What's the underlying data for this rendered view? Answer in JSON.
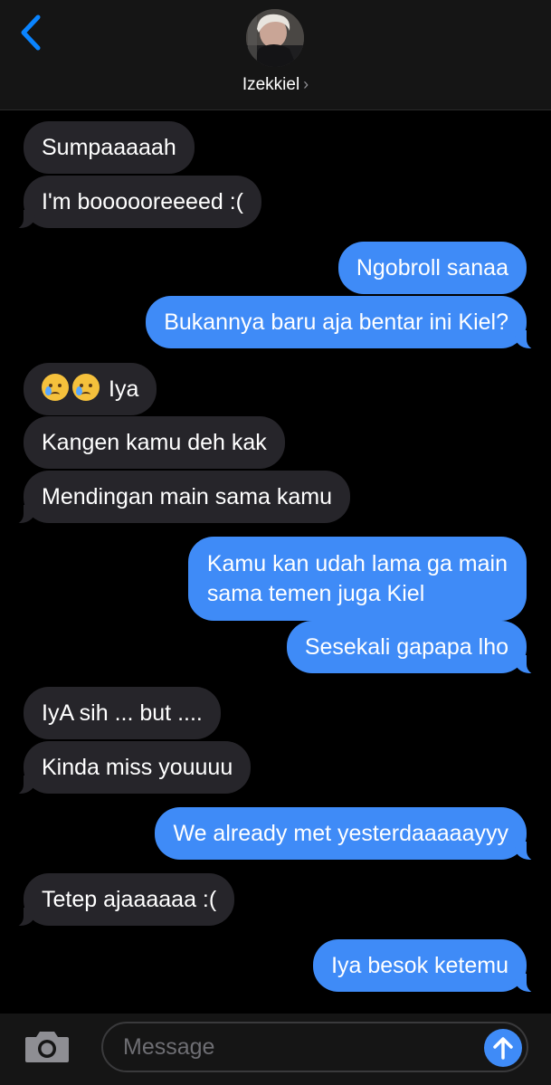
{
  "header": {
    "contact_name": "Izekkiel",
    "chevron": "›",
    "back_icon": "chevron-left-icon",
    "avatar": "contact-avatar"
  },
  "colors": {
    "incoming": "#26252a",
    "outgoing": "#3f8bf7",
    "accent": "#0a84ff",
    "background": "#000000"
  },
  "messages": [
    {
      "dir": "in",
      "text": "Sumpaaaaah"
    },
    {
      "dir": "in",
      "text": "I'm boooooreeeed :("
    },
    {
      "dir": "out",
      "text": "Ngobroll sanaa"
    },
    {
      "dir": "out",
      "text": "Bukannya baru aja bentar ini Kiel?"
    },
    {
      "dir": "in",
      "text": "Iya",
      "emojis": [
        "crying-face-icon",
        "crying-face-icon"
      ]
    },
    {
      "dir": "in",
      "text": "Kangen kamu deh kak"
    },
    {
      "dir": "in",
      "text": "Mendingan main sama kamu"
    },
    {
      "dir": "out",
      "text_line1": "Kamu kan udah lama ga main",
      "text_line2": "sama temen juga Kiel"
    },
    {
      "dir": "out",
      "text": "Sesekali gapapa lho"
    },
    {
      "dir": "in",
      "text": "IyA sih ... but ...."
    },
    {
      "dir": "in",
      "text": "Kinda miss youuuu"
    },
    {
      "dir": "out",
      "text": "We already met yesterdaaaaayyy"
    },
    {
      "dir": "in",
      "text": "Tetep ajaaaaaa :("
    },
    {
      "dir": "out",
      "text": "Iya besok ketemu"
    }
  ],
  "composer": {
    "placeholder": "Message",
    "camera_icon": "camera-icon",
    "send_icon": "arrow-up-icon"
  }
}
